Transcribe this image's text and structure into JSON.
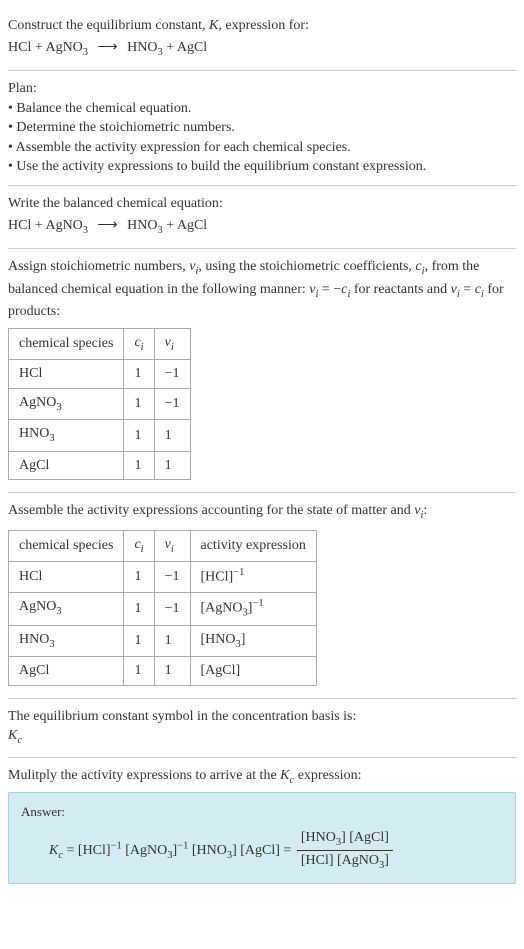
{
  "intro": {
    "line1": "Construct the equilibrium constant, ",
    "k": "K",
    "line1b": ", expression for:",
    "equation_lhs": "HCl + AgNO",
    "equation_sub1": "3",
    "equation_rhs": "HNO",
    "equation_sub2": "3",
    "equation_tail": " + AgCl"
  },
  "plan": {
    "title": "Plan:",
    "items": [
      "• Balance the chemical equation.",
      "• Determine the stoichiometric numbers.",
      "• Assemble the activity expression for each chemical species.",
      "• Use the activity expressions to build the equilibrium constant expression."
    ]
  },
  "balanced": {
    "title": "Write the balanced chemical equation:"
  },
  "assign": {
    "text1": "Assign stoichiometric numbers, ",
    "nu": "ν",
    "sub_i": "i",
    "text2": ", using the stoichiometric coefficients, ",
    "c": "c",
    "text3": ", from the balanced chemical equation in the following manner: ",
    "eq1_lhs": "ν",
    "eq1_mid": " = −",
    "text4": " for reactants and ",
    "eq2_mid": " = ",
    "text5": " for products:",
    "headers": [
      "chemical species",
      "c",
      "ν"
    ],
    "rows": [
      {
        "species": "HCl",
        "c": "1",
        "nu": "−1"
      },
      {
        "species": "AgNO",
        "sub": "3",
        "c": "1",
        "nu": "−1"
      },
      {
        "species": "HNO",
        "sub": "3",
        "c": "1",
        "nu": "1"
      },
      {
        "species": "AgCl",
        "c": "1",
        "nu": "1"
      }
    ]
  },
  "assemble": {
    "title": "Assemble the activity expressions accounting for the state of matter and ",
    "headers": [
      "chemical species",
      "c",
      "ν",
      "activity expression"
    ],
    "rows": [
      {
        "species": "HCl",
        "c": "1",
        "nu": "−1",
        "act_l": "[HCl]",
        "sup": "−1"
      },
      {
        "species": "AgNO",
        "sub": "3",
        "c": "1",
        "nu": "−1",
        "act_l": "[AgNO",
        "act_sub": "3",
        "act_r": "]",
        "sup": "−1"
      },
      {
        "species": "HNO",
        "sub": "3",
        "c": "1",
        "nu": "1",
        "act_l": "[HNO",
        "act_sub": "3",
        "act_r": "]"
      },
      {
        "species": "AgCl",
        "c": "1",
        "nu": "1",
        "act_l": "[AgCl]"
      }
    ]
  },
  "symbol": {
    "line1": "The equilibrium constant symbol in the concentration basis is:",
    "kc": "K",
    "kc_sub": "c"
  },
  "multiply": {
    "title": "Mulitply the activity expressions to arrive at the ",
    "kc": "K",
    "kc_sub": "c",
    "title2": " expression:"
  },
  "answer": {
    "label": "Answer:",
    "kc": "K",
    "kc_sub": "c",
    "eq": " = [HCl]",
    "sup1": "−1",
    "part2": " [AgNO",
    "sub1": "3",
    "part2b": "]",
    "sup2": "−1",
    "part3": " [HNO",
    "sub2": "3",
    "part3b": "] [AgCl] = ",
    "num": "[HNO",
    "num_sub": "3",
    "num2": "] [AgCl]",
    "den": "[HCl] [AgNO",
    "den_sub": "3",
    "den2": "]"
  },
  "arrow": "⟶"
}
